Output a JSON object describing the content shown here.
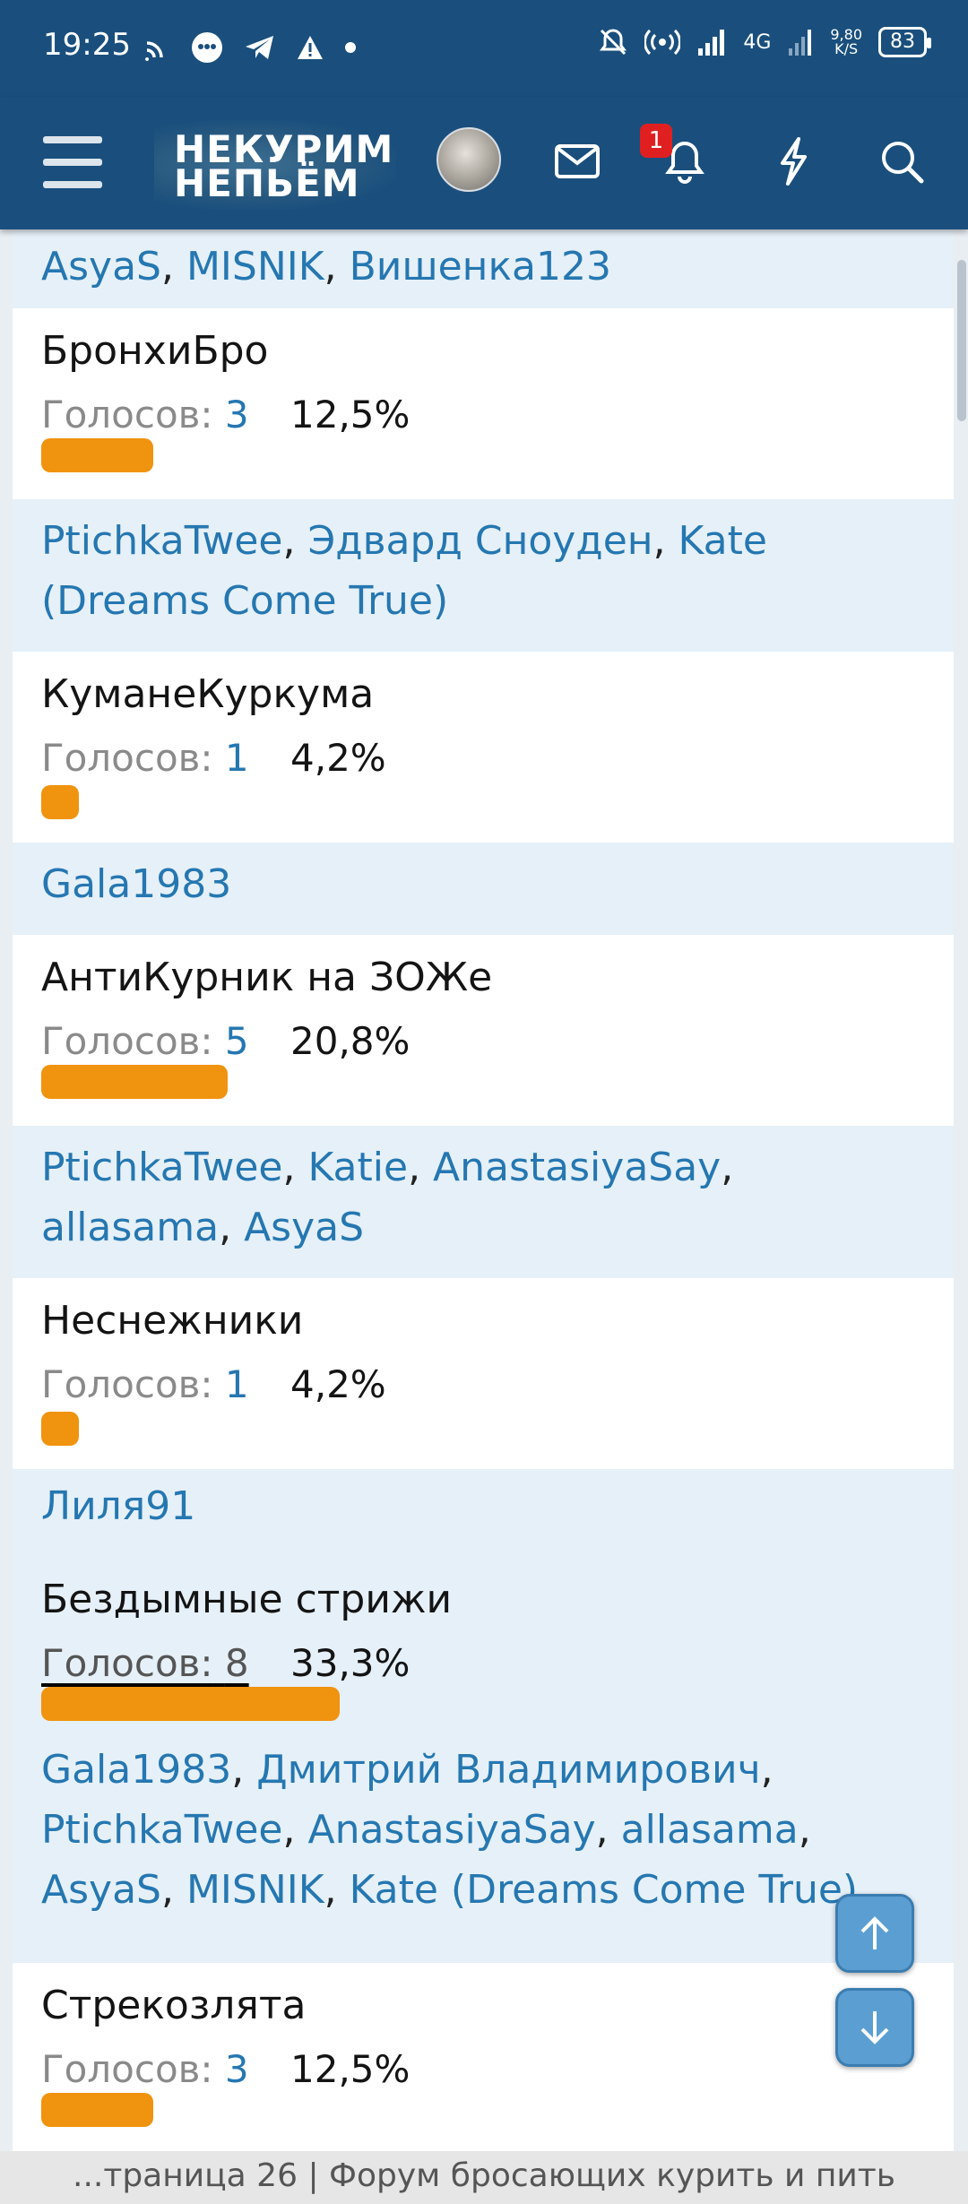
{
  "status_bar": {
    "time": "19:25",
    "network": "4G",
    "speed_value": "9,80",
    "speed_unit": "K/S",
    "battery": "83"
  },
  "header": {
    "logo_line1": "НЕКУРИМ",
    "logo_line2": "НЕПЬЁМ",
    "notification_count": "1"
  },
  "poll": {
    "top_voters": [
      "AsyaS",
      "MISNIK",
      "Вишенка123"
    ],
    "votes_label": "Голосов:",
    "options": [
      {
        "title": "БронхиБро",
        "votes": "3",
        "percent": "12,5%",
        "share": 0.125,
        "voters": [
          "PtichkaTwee",
          "Эдвард Сноуден",
          "Kate (Dreams Come True)"
        ]
      },
      {
        "title": "КуманеКуркума",
        "votes": "1",
        "percent": "4,2%",
        "share": 0.042,
        "voters": [
          "Gala1983"
        ]
      },
      {
        "title": "АнтиКурник на ЗОЖе",
        "votes": "5",
        "percent": "20,8%",
        "share": 0.208,
        "voters": [
          "PtichkaTwee",
          "Katie",
          "AnastasiyaSay",
          "allasama",
          "AsyaS"
        ]
      },
      {
        "title": "Неснежники",
        "votes": "1",
        "percent": "4,2%",
        "share": 0.042,
        "voters": [
          "Лиля91"
        ]
      },
      {
        "title": "Бездымные стрижи",
        "votes": "8",
        "percent": "33,3%",
        "share": 0.333,
        "highlighted": true,
        "voters": [
          "Gala1983",
          "Дмитрий Владимирович",
          "PtichkaTwee",
          "AnastasiyaSay",
          "allasama",
          "AsyaS",
          "MISNIK",
          "Kate (Dreams Come True)"
        ]
      },
      {
        "title": "Стрекозлята",
        "votes": "3",
        "percent": "12,5%",
        "share": 0.125
      }
    ]
  },
  "page_title": "...траница 26 | Форум бросающих курить и пить"
}
